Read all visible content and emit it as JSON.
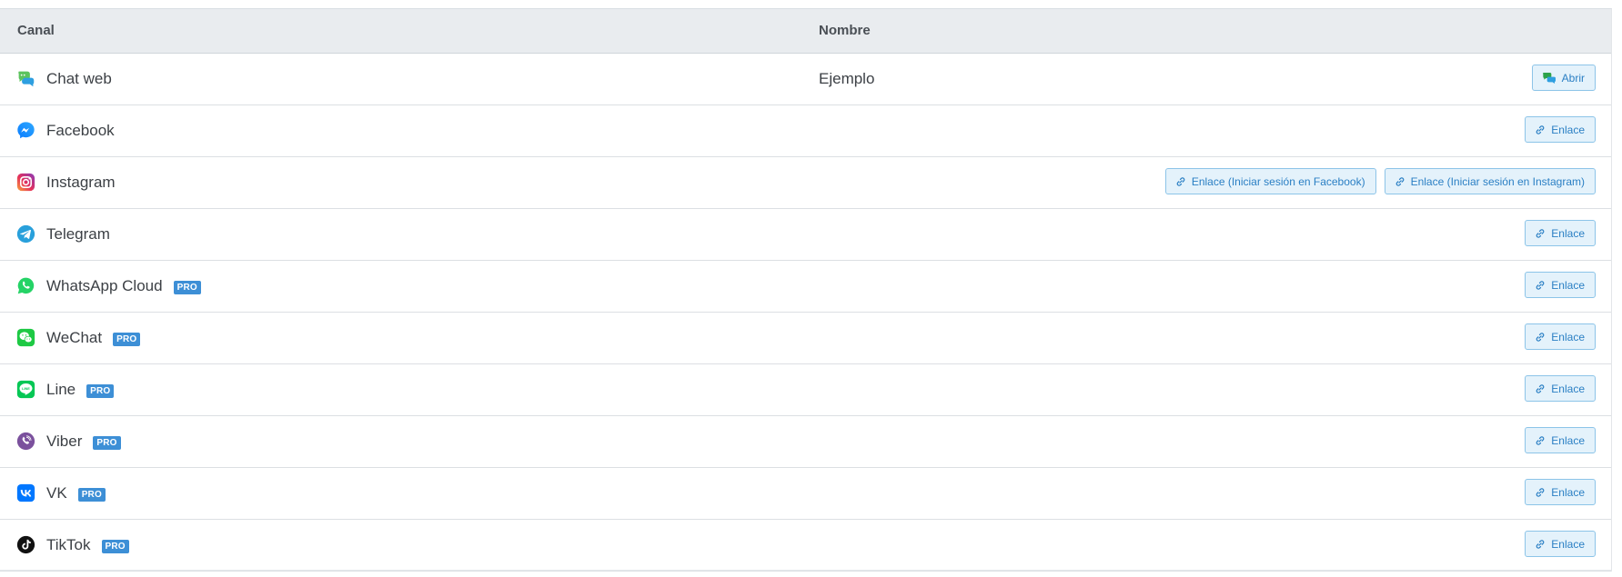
{
  "table": {
    "headers": {
      "canal": "Canal",
      "nombre": "Nombre"
    },
    "rows": [
      {
        "channel": "Chat web",
        "icon": "chat-web-icon",
        "name": "Ejemplo",
        "pro": "",
        "buttons": [
          {
            "label": "Abrir",
            "icon": "chat-bubbles-icon"
          }
        ]
      },
      {
        "channel": "Facebook",
        "icon": "facebook-messenger-icon",
        "name": "",
        "pro": "",
        "buttons": [
          {
            "label": "Enlace",
            "icon": "link-icon"
          }
        ]
      },
      {
        "channel": "Instagram",
        "icon": "instagram-icon",
        "name": "",
        "pro": "",
        "buttons": [
          {
            "label": "Enlace (Iniciar sesión en Facebook)",
            "icon": "link-icon"
          },
          {
            "label": "Enlace (Iniciar sesión en Instagram)",
            "icon": "link-icon"
          }
        ]
      },
      {
        "channel": "Telegram",
        "icon": "telegram-icon",
        "name": "",
        "pro": "",
        "buttons": [
          {
            "label": "Enlace",
            "icon": "link-icon"
          }
        ]
      },
      {
        "channel": "WhatsApp Cloud",
        "icon": "whatsapp-icon",
        "name": "",
        "pro": "PRO",
        "buttons": [
          {
            "label": "Enlace",
            "icon": "link-icon"
          }
        ]
      },
      {
        "channel": "WeChat",
        "icon": "wechat-icon",
        "name": "",
        "pro": "PRO",
        "buttons": [
          {
            "label": "Enlace",
            "icon": "link-icon"
          }
        ]
      },
      {
        "channel": "Line",
        "icon": "line-icon",
        "name": "",
        "pro": "PRO",
        "buttons": [
          {
            "label": "Enlace",
            "icon": "link-icon"
          }
        ]
      },
      {
        "channel": "Viber",
        "icon": "viber-icon",
        "name": "",
        "pro": "PRO",
        "buttons": [
          {
            "label": "Enlace",
            "icon": "link-icon"
          }
        ]
      },
      {
        "channel": "VK",
        "icon": "vk-icon",
        "name": "",
        "pro": "PRO",
        "buttons": [
          {
            "label": "Enlace",
            "icon": "link-icon"
          }
        ]
      },
      {
        "channel": "TikTok",
        "icon": "tiktok-icon",
        "name": "",
        "pro": "PRO",
        "buttons": [
          {
            "label": "Enlace",
            "icon": "link-icon"
          }
        ]
      }
    ]
  },
  "colors": {
    "header_bg": "#e9ecef",
    "button_bg": "#e4f2fb",
    "button_border": "#8cc4e8",
    "button_text": "#2a7fc4",
    "pro_badge": "#3d8fd6"
  }
}
